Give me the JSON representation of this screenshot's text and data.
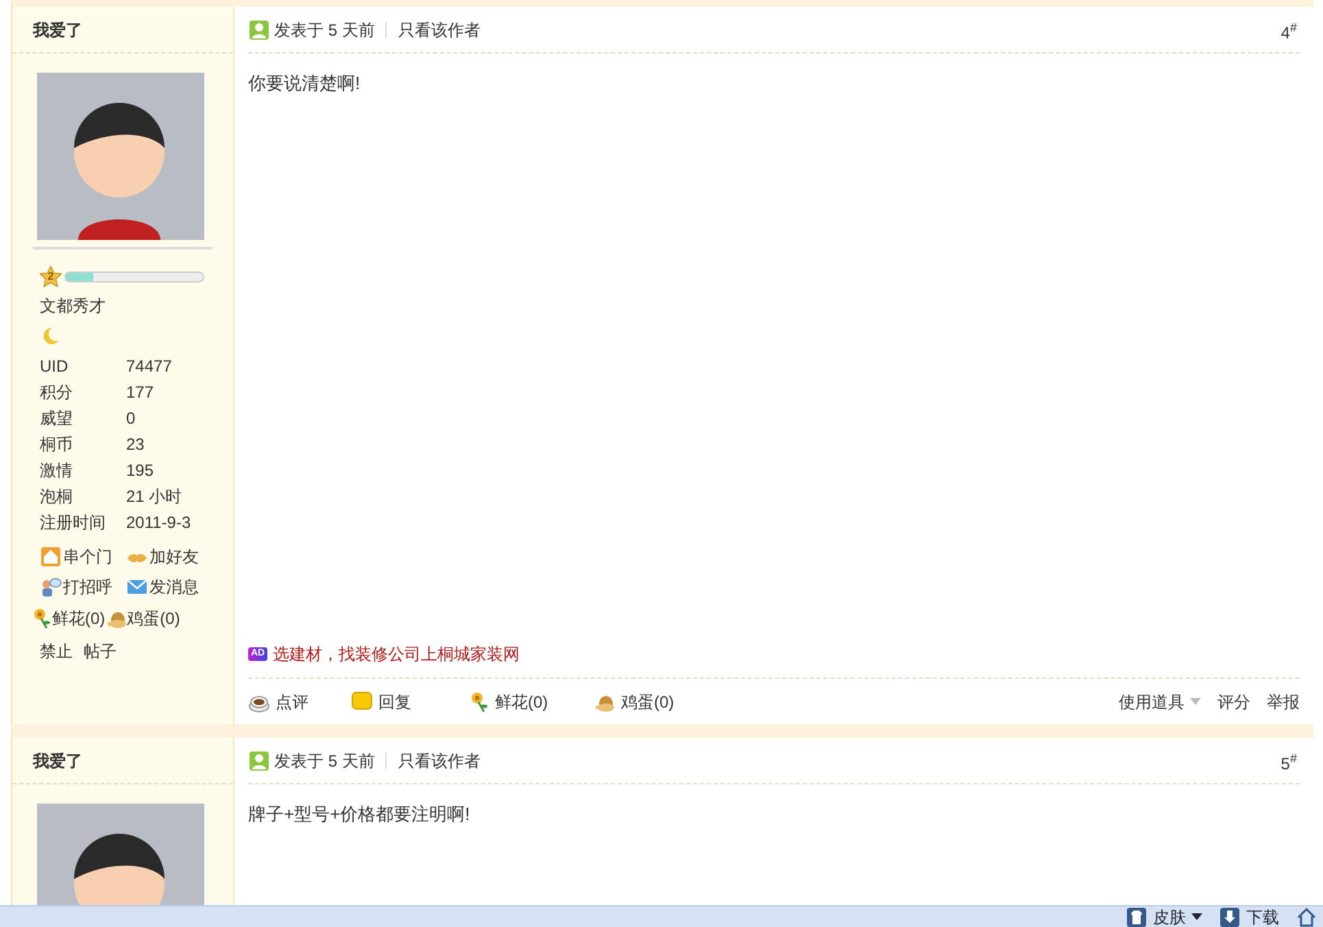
{
  "posts": [
    {
      "author": "我爱了",
      "level_badge": "2",
      "level": 0.2,
      "rank": "文都秀才",
      "stats": [
        {
          "label": "UID",
          "value": "74477"
        },
        {
          "label": "积分",
          "value": "177"
        },
        {
          "label": "威望",
          "value": "0"
        },
        {
          "label": "桐币",
          "value": "23"
        },
        {
          "label": "激情",
          "value": "195"
        },
        {
          "label": "泡桐",
          "value": "21 小时"
        },
        {
          "label": "注册时间",
          "value": "2011-9-3"
        }
      ],
      "profile_actions": [
        {
          "kind": "home",
          "label": "串个门"
        },
        {
          "kind": "friend",
          "label": "加好友"
        },
        {
          "kind": "greet",
          "label": "打招呼"
        },
        {
          "kind": "message",
          "label": "发消息"
        }
      ],
      "gifts": [
        {
          "kind": "flower",
          "label": "鲜花(0)"
        },
        {
          "kind": "egg",
          "label": "鸡蛋(0)"
        }
      ],
      "admin_links": [
        "禁止",
        "帖子"
      ],
      "posted": "发表于 5 天前",
      "author_only": "只看该作者",
      "floor": "4$^{#}$",
      "content": "你要说清楚啊!",
      "ad": "选建材，找装修公司上桐城家装网",
      "ad_badge": "AD",
      "footer_left": [
        {
          "kind": "comment",
          "label": "点评"
        },
        {
          "kind": "reply",
          "label": "回复"
        },
        {
          "kind": "flower",
          "label": "鲜花(0)"
        },
        {
          "kind": "egg",
          "label": "鸡蛋(0)"
        }
      ],
      "footer_right": [
        {
          "kind": "dropdown",
          "label": "使用道具"
        },
        {
          "kind": "link",
          "label": "评分"
        },
        {
          "kind": "link",
          "label": "举报"
        }
      ]
    },
    {
      "author": "我爱了",
      "posted": "发表于 5 天前",
      "author_only": "只看该作者",
      "floor": "5$^{#}$",
      "content": "牌子+型号+价格都要注明啊!"
    }
  ],
  "bottom_bar": [
    {
      "kind": "skin",
      "label": "皮肤",
      "dropdown": true
    },
    {
      "kind": "download",
      "label": "下载",
      "dropdown": false
    }
  ]
}
